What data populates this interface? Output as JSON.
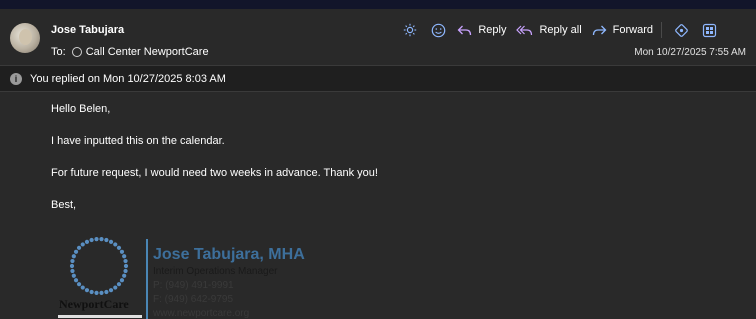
{
  "header": {
    "sender": "Jose Tabujara",
    "to_label": "To:",
    "recipient": "Call Center NewportCare",
    "date": "Mon 10/27/2025 7:55 AM"
  },
  "toolbar": {
    "reply_label": "Reply",
    "reply_all_label": "Reply all",
    "forward_label": "Forward"
  },
  "info_bar": {
    "text": "You replied on Mon 10/27/2025 8:03 AM"
  },
  "message": {
    "greeting": "Hello Belen,",
    "line1": "I have inputted this on the calendar.",
    "line2": "For future request, I would need two weeks in advance. Thank you!",
    "closing": "Best,"
  },
  "signature": {
    "brand": "NewportCare",
    "name": "Jose Tabujara, MHA",
    "title": "Interim Operations Manager",
    "phone": "P: (949) 491-9991",
    "fax": "F: (949) 642-9795",
    "website": "www.newportcare.org"
  },
  "colors": {
    "background": "#292929",
    "topstrip": "#12152a",
    "signature_name": "#3d6f9b",
    "reply_all_icon": "#c9a3ff",
    "forward_icon": "#8fb8ff",
    "toolbar_icon": "#8fb8ff"
  }
}
